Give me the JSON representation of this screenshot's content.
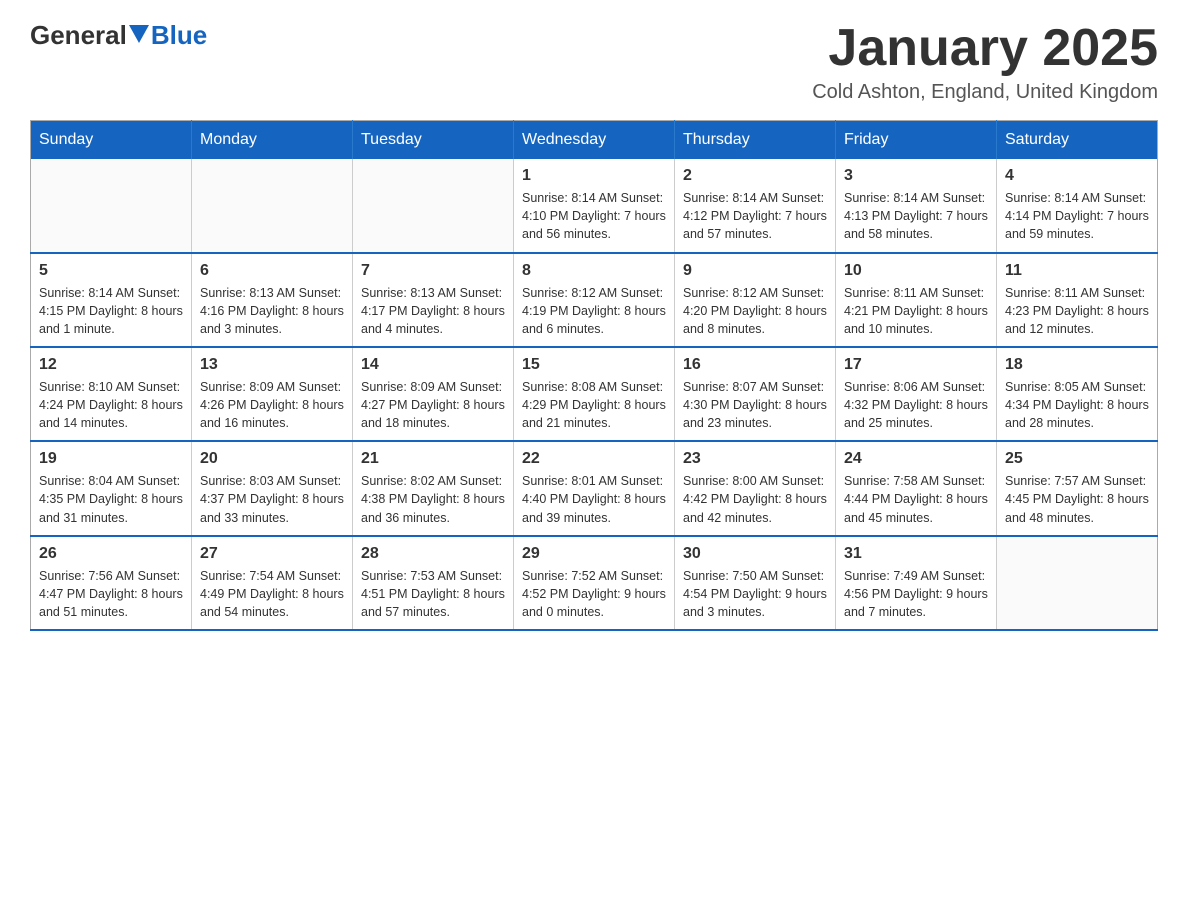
{
  "logo": {
    "general": "General",
    "blue": "Blue"
  },
  "title": "January 2025",
  "subtitle": "Cold Ashton, England, United Kingdom",
  "days_of_week": [
    "Sunday",
    "Monday",
    "Tuesday",
    "Wednesday",
    "Thursday",
    "Friday",
    "Saturday"
  ],
  "weeks": [
    [
      {
        "day": "",
        "info": ""
      },
      {
        "day": "",
        "info": ""
      },
      {
        "day": "",
        "info": ""
      },
      {
        "day": "1",
        "info": "Sunrise: 8:14 AM\nSunset: 4:10 PM\nDaylight: 7 hours\nand 56 minutes."
      },
      {
        "day": "2",
        "info": "Sunrise: 8:14 AM\nSunset: 4:12 PM\nDaylight: 7 hours\nand 57 minutes."
      },
      {
        "day": "3",
        "info": "Sunrise: 8:14 AM\nSunset: 4:13 PM\nDaylight: 7 hours\nand 58 minutes."
      },
      {
        "day": "4",
        "info": "Sunrise: 8:14 AM\nSunset: 4:14 PM\nDaylight: 7 hours\nand 59 minutes."
      }
    ],
    [
      {
        "day": "5",
        "info": "Sunrise: 8:14 AM\nSunset: 4:15 PM\nDaylight: 8 hours\nand 1 minute."
      },
      {
        "day": "6",
        "info": "Sunrise: 8:13 AM\nSunset: 4:16 PM\nDaylight: 8 hours\nand 3 minutes."
      },
      {
        "day": "7",
        "info": "Sunrise: 8:13 AM\nSunset: 4:17 PM\nDaylight: 8 hours\nand 4 minutes."
      },
      {
        "day": "8",
        "info": "Sunrise: 8:12 AM\nSunset: 4:19 PM\nDaylight: 8 hours\nand 6 minutes."
      },
      {
        "day": "9",
        "info": "Sunrise: 8:12 AM\nSunset: 4:20 PM\nDaylight: 8 hours\nand 8 minutes."
      },
      {
        "day": "10",
        "info": "Sunrise: 8:11 AM\nSunset: 4:21 PM\nDaylight: 8 hours\nand 10 minutes."
      },
      {
        "day": "11",
        "info": "Sunrise: 8:11 AM\nSunset: 4:23 PM\nDaylight: 8 hours\nand 12 minutes."
      }
    ],
    [
      {
        "day": "12",
        "info": "Sunrise: 8:10 AM\nSunset: 4:24 PM\nDaylight: 8 hours\nand 14 minutes."
      },
      {
        "day": "13",
        "info": "Sunrise: 8:09 AM\nSunset: 4:26 PM\nDaylight: 8 hours\nand 16 minutes."
      },
      {
        "day": "14",
        "info": "Sunrise: 8:09 AM\nSunset: 4:27 PM\nDaylight: 8 hours\nand 18 minutes."
      },
      {
        "day": "15",
        "info": "Sunrise: 8:08 AM\nSunset: 4:29 PM\nDaylight: 8 hours\nand 21 minutes."
      },
      {
        "day": "16",
        "info": "Sunrise: 8:07 AM\nSunset: 4:30 PM\nDaylight: 8 hours\nand 23 minutes."
      },
      {
        "day": "17",
        "info": "Sunrise: 8:06 AM\nSunset: 4:32 PM\nDaylight: 8 hours\nand 25 minutes."
      },
      {
        "day": "18",
        "info": "Sunrise: 8:05 AM\nSunset: 4:34 PM\nDaylight: 8 hours\nand 28 minutes."
      }
    ],
    [
      {
        "day": "19",
        "info": "Sunrise: 8:04 AM\nSunset: 4:35 PM\nDaylight: 8 hours\nand 31 minutes."
      },
      {
        "day": "20",
        "info": "Sunrise: 8:03 AM\nSunset: 4:37 PM\nDaylight: 8 hours\nand 33 minutes."
      },
      {
        "day": "21",
        "info": "Sunrise: 8:02 AM\nSunset: 4:38 PM\nDaylight: 8 hours\nand 36 minutes."
      },
      {
        "day": "22",
        "info": "Sunrise: 8:01 AM\nSunset: 4:40 PM\nDaylight: 8 hours\nand 39 minutes."
      },
      {
        "day": "23",
        "info": "Sunrise: 8:00 AM\nSunset: 4:42 PM\nDaylight: 8 hours\nand 42 minutes."
      },
      {
        "day": "24",
        "info": "Sunrise: 7:58 AM\nSunset: 4:44 PM\nDaylight: 8 hours\nand 45 minutes."
      },
      {
        "day": "25",
        "info": "Sunrise: 7:57 AM\nSunset: 4:45 PM\nDaylight: 8 hours\nand 48 minutes."
      }
    ],
    [
      {
        "day": "26",
        "info": "Sunrise: 7:56 AM\nSunset: 4:47 PM\nDaylight: 8 hours\nand 51 minutes."
      },
      {
        "day": "27",
        "info": "Sunrise: 7:54 AM\nSunset: 4:49 PM\nDaylight: 8 hours\nand 54 minutes."
      },
      {
        "day": "28",
        "info": "Sunrise: 7:53 AM\nSunset: 4:51 PM\nDaylight: 8 hours\nand 57 minutes."
      },
      {
        "day": "29",
        "info": "Sunrise: 7:52 AM\nSunset: 4:52 PM\nDaylight: 9 hours\nand 0 minutes."
      },
      {
        "day": "30",
        "info": "Sunrise: 7:50 AM\nSunset: 4:54 PM\nDaylight: 9 hours\nand 3 minutes."
      },
      {
        "day": "31",
        "info": "Sunrise: 7:49 AM\nSunset: 4:56 PM\nDaylight: 9 hours\nand 7 minutes."
      },
      {
        "day": "",
        "info": ""
      }
    ]
  ]
}
